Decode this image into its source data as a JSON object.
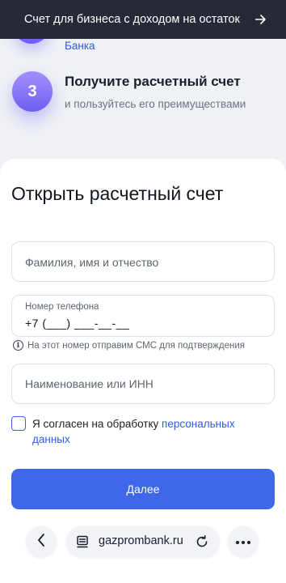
{
  "banner": {
    "text": "Счет для бизнеса с доходом на остаток",
    "arrow_icon": "arrow-right-icon"
  },
  "steps": {
    "step2_tail": "Банка",
    "step3": {
      "number": "3",
      "title": "Получите расчетный счет",
      "subtitle": "и пользуйтесь его преимуществами"
    }
  },
  "form": {
    "title": "Открыть расчетный счет",
    "name_placeholder": "Фамилия, имя и отчество",
    "phone_label": "Номер телефона",
    "phone_value": "+7 (___) ___-__-__",
    "phone_hint": "На этот номер отправим СМС для подтверждения",
    "org_placeholder": "Наименование или ИНН",
    "consent_text": "Я согласен на обработку ",
    "consent_link": "персональных данных",
    "consent_checked": false,
    "submit_label": "Далее"
  },
  "browser": {
    "url": "gazprombank.ru",
    "icons": [
      "chevron-left-icon",
      "page-icon",
      "reload-icon",
      "more-icon"
    ]
  },
  "colors": {
    "primary": "#3f67ea",
    "link": "#2f5bde",
    "banner_bg": "#262a37",
    "step_gradient": [
      "#a390ff",
      "#6c5ff2"
    ]
  }
}
